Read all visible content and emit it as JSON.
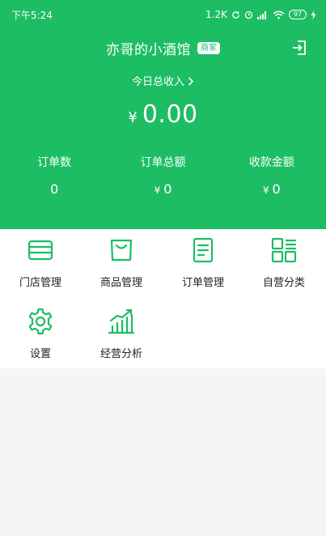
{
  "status_bar": {
    "time": "下午5:24",
    "network_speed": "1.2K",
    "battery": "97"
  },
  "header": {
    "shop_name": "亦哥的小酒馆",
    "badge": "商家"
  },
  "income": {
    "link_label": "今日总收入",
    "currency": "¥",
    "amount": "0.00"
  },
  "stats": [
    {
      "label": "订单数",
      "value": "0",
      "currency": ""
    },
    {
      "label": "订单总额",
      "value": "0",
      "currency": "¥"
    },
    {
      "label": "收款金额",
      "value": "0",
      "currency": "¥"
    }
  ],
  "menu": [
    {
      "label": "门店管理",
      "icon": "store-icon"
    },
    {
      "label": "商品管理",
      "icon": "shopping-bag-icon"
    },
    {
      "label": "订单管理",
      "icon": "document-icon"
    },
    {
      "label": "自营分类",
      "icon": "category-grid-icon"
    },
    {
      "label": "设置",
      "icon": "gear-icon"
    },
    {
      "label": "经营分析",
      "icon": "analytics-chart-icon"
    }
  ],
  "colors": {
    "brand_green": "#1dbd64",
    "background": "#f5f5f5"
  }
}
